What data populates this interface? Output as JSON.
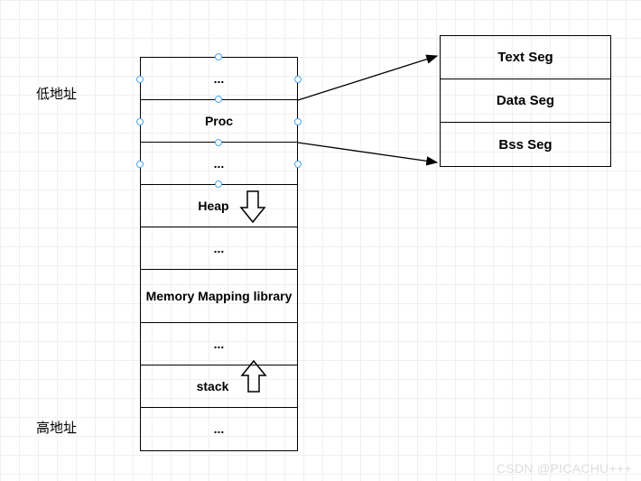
{
  "labels": {
    "low_addr": "低地址",
    "high_addr": "高地址"
  },
  "main_rows": [
    "...",
    "Proc",
    "...",
    "Heap",
    "...",
    "Memory Mapping library",
    "...",
    "stack",
    "..."
  ],
  "right_rows": [
    "Text Seg",
    "Data Seg",
    "Bss Seg"
  ],
  "watermark": "CSDN @PICACHU+++"
}
